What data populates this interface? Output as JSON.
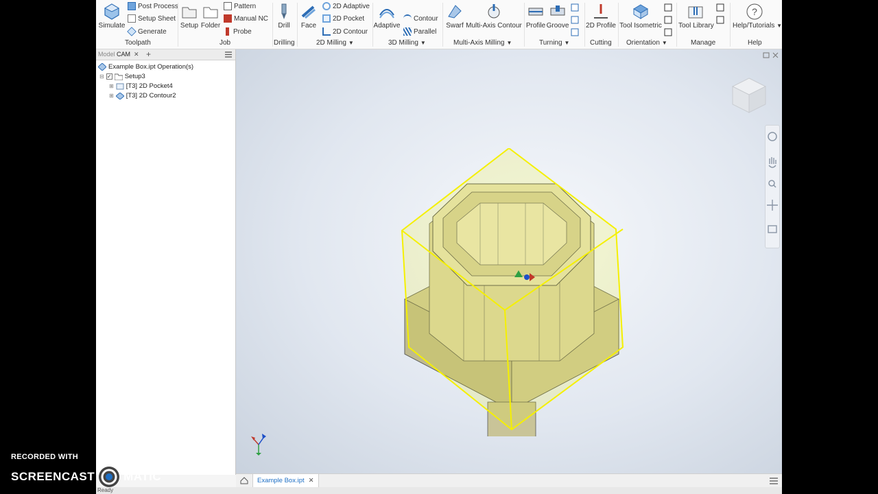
{
  "ribbon": {
    "toolpath": {
      "simulate": "Simulate",
      "post_process": "Post Process",
      "setup_sheet": "Setup Sheet",
      "generate": "Generate",
      "label": "Toolpath"
    },
    "job": {
      "setup": "Setup",
      "folder": "Folder",
      "pattern": "Pattern",
      "manual_nc": "Manual NC",
      "probe": "Probe",
      "label": "Job"
    },
    "drilling": {
      "drill": "Drill",
      "label": "Drilling"
    },
    "milling2d": {
      "face": "Face",
      "adaptive": "2D Adaptive",
      "pocket": "2D Pocket",
      "contour": "2D Contour",
      "label": "2D Milling"
    },
    "milling3d": {
      "adaptive": "Adaptive",
      "contour": "Contour",
      "parallel": "Parallel",
      "label": "3D Milling"
    },
    "multiaxis": {
      "swarf": "Swarf",
      "contour": "Multi-Axis Contour",
      "label": "Multi-Axis Milling"
    },
    "turning": {
      "profile": "Profile",
      "groove": "Groove",
      "label": "Turning"
    },
    "cutting": {
      "profile2d": "2D Profile",
      "label": "Cutting"
    },
    "orientation": {
      "iso": "Tool Isometric",
      "label": "Orientation"
    },
    "manage": {
      "library": "Tool Library",
      "label": "Manage"
    },
    "help": {
      "tutorials": "Help/Tutorials",
      "label": "Help"
    }
  },
  "panel": {
    "tabs": {
      "model": "Model",
      "cam": "CAM",
      "close": "✕",
      "add": "+"
    },
    "tree": {
      "root": "Example Box.ipt Operation(s)",
      "setup": "Setup3",
      "op1": "[T3] 2D Pocket4",
      "op2": "[T3] 2D Contour2"
    }
  },
  "doc_tabs": {
    "active": "Example Box.ipt",
    "close": "✕"
  },
  "status": {
    "text": "Ready"
  },
  "watermark": {
    "line1": "RECORDED WITH",
    "line2a": "SCREENCAST",
    "line2b": "MATIC"
  },
  "colors": {
    "accent": "#1e6fc4",
    "selection": "#f5f000",
    "part": "#d6d2a6"
  }
}
